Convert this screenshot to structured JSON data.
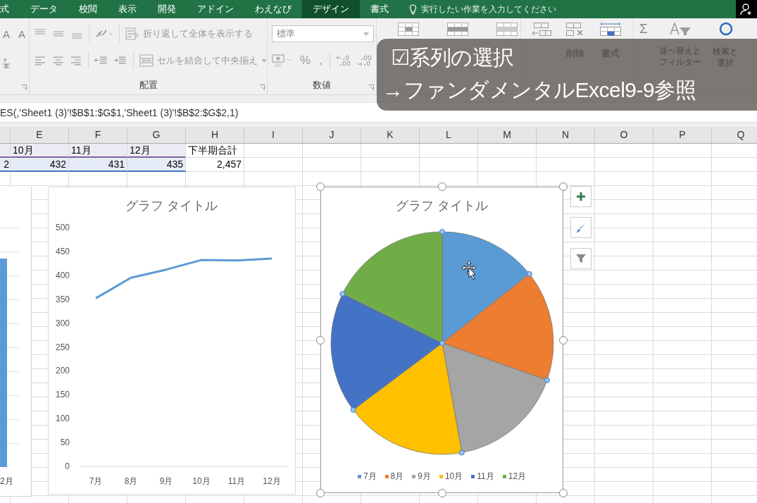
{
  "ribbon_tabs": [
    {
      "label": "式",
      "selected": false
    },
    {
      "label": "データ",
      "selected": false
    },
    {
      "label": "校閲",
      "selected": false
    },
    {
      "label": "表示",
      "selected": false
    },
    {
      "label": "開発",
      "selected": false
    },
    {
      "label": "アドイン",
      "selected": false
    },
    {
      "label": "わえなび",
      "selected": false
    },
    {
      "label": "デザイン",
      "selected": true
    },
    {
      "label": "書式",
      "selected": false
    }
  ],
  "tell_me": {
    "placeholder": "実行したい作業を入力してください"
  },
  "font_group": {
    "grow": "A",
    "shrink": "A"
  },
  "alignment_group": {
    "label": "配置",
    "wrap_text": "折り返して全体を表示する",
    "merge_center": "セルを結合して中央揃え"
  },
  "number_group": {
    "label": "数値",
    "format": "標準",
    "percent": "%",
    "comma": ","
  },
  "cells_group": {
    "delete": "削除",
    "format": "書式"
  },
  "editing_group": {
    "autosum": "Σ",
    "sort_filter": [
      "並べ替えと",
      "フィルター"
    ],
    "find_select": [
      "検索と",
      "選択"
    ]
  },
  "formula_bar": {
    "value": "ES(,'Sheet1 (3)'!$B$1:$G$1,'Sheet1 (3)'!$B$2:$G$2,1)"
  },
  "columns": [
    "E",
    "F",
    "G",
    "H",
    "I",
    "J",
    "K",
    "L",
    "M",
    "N",
    "O",
    "P",
    "Q"
  ],
  "rows": [
    {
      "kind": "labels",
      "color": "#8064a2",
      "partial_cell": {
        "highlighted": true
      },
      "cells": [
        {
          "text": "10月",
          "highlighted": true
        },
        {
          "text": "11月",
          "highlighted": true
        },
        {
          "text": "12月",
          "highlighted": true
        },
        {
          "text": "下半期合計",
          "highlighted": false
        }
      ]
    },
    {
      "kind": "numbers",
      "color": "#4472c4",
      "partial_cell": {
        "text": "2",
        "highlighted": true
      },
      "cells": [
        {
          "text": "432",
          "highlighted": true
        },
        {
          "text": "431",
          "highlighted": true
        },
        {
          "text": "435",
          "highlighted": true
        },
        {
          "text": "2,457",
          "highlighted": false
        }
      ]
    }
  ],
  "bar_chart": {
    "category_label": "2月"
  },
  "line_chart": {
    "chart_data": {
      "type": "line",
      "title": "グラフ タイトル",
      "categories": [
        "7月",
        "8月",
        "9月",
        "10月",
        "11月",
        "12月"
      ],
      "series": [
        {
          "color": "#5b9bd5",
          "values": [
            352,
            395,
            412,
            432,
            431,
            435
          ]
        }
      ],
      "ylim": [
        0,
        500
      ],
      "yticks": [
        0,
        50,
        100,
        150,
        200,
        250,
        300,
        350,
        400,
        450,
        500
      ]
    }
  },
  "pie_chart": {
    "selected": true,
    "slices": [
      {
        "color": "#5b9bd5"
      },
      {
        "color": "#ed7d31"
      },
      {
        "color": "#a5a5a5"
      },
      {
        "color": "#ffc000"
      },
      {
        "color": "#4472c4"
      },
      {
        "color": "#70ad47"
      }
    ],
    "chart_data": {
      "type": "pie",
      "title": "グラフ タイトル",
      "legend": "bottom",
      "categories": [
        "7月",
        "8月",
        "9月",
        "10月",
        "11月",
        "12月"
      ],
      "series": [
        {
          "values": [
            14.33,
            16.08,
            16.77,
            17.58,
            17.54,
            17.7
          ]
        }
      ]
    }
  },
  "caption": {
    "lines": [
      "☑系列の選択",
      "→ファンダメンタルExcel9-9参照"
    ]
  }
}
